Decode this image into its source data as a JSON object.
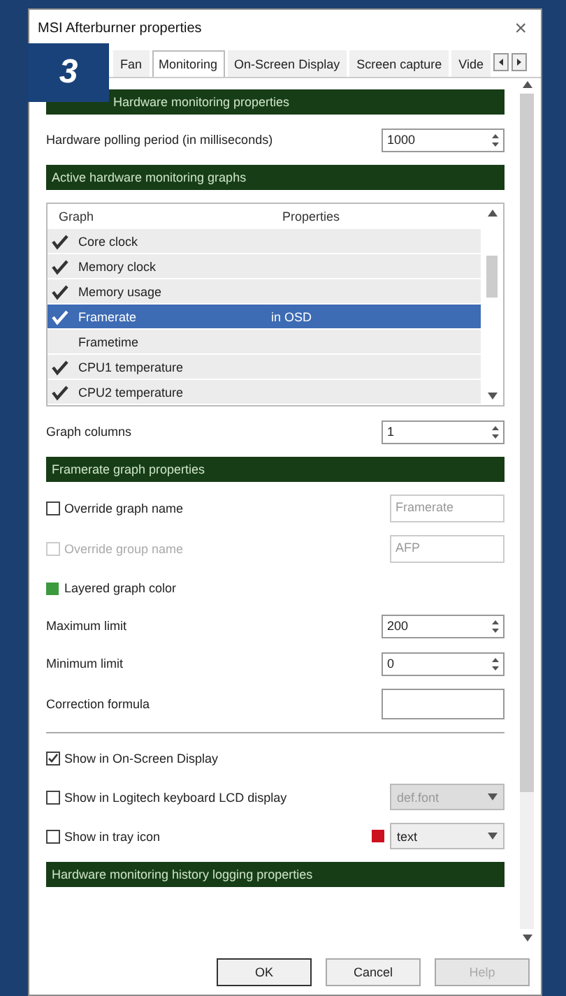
{
  "window": {
    "title": "MSI Afterburner properties",
    "close": "×"
  },
  "badge": "3",
  "tabs": [
    {
      "label": "Fan",
      "selected": false
    },
    {
      "label": "Monitoring",
      "selected": true
    },
    {
      "label": "On-Screen Display",
      "selected": false
    },
    {
      "label": "Screen capture",
      "selected": false
    },
    {
      "label": "Vide",
      "selected": false
    }
  ],
  "hardware_monitoring": {
    "heading": "Hardware monitoring properties",
    "polling_label": "Hardware polling period (in milliseconds)",
    "polling_value": "1000"
  },
  "graphs": {
    "heading": "Active hardware monitoring graphs",
    "columns": [
      "Graph",
      "Properties"
    ],
    "rows": [
      {
        "name": "Core clock",
        "checked": true,
        "selected": false
      },
      {
        "name": "Memory clock",
        "checked": true,
        "selected": false
      },
      {
        "name": "Memory usage",
        "checked": true,
        "selected": false
      },
      {
        "name": "Framerate",
        "properties": "in OSD",
        "checked": true,
        "selected": true
      },
      {
        "name": "Frametime",
        "checked": false,
        "selected": false
      },
      {
        "name": "CPU1 temperature",
        "checked": true,
        "selected": false
      },
      {
        "name": "CPU2 temperature",
        "checked": true,
        "selected": false
      }
    ]
  },
  "graph_columns": {
    "label": "Graph columns",
    "value": "1"
  },
  "graph_properties": {
    "heading": "Framerate graph properties",
    "fields": [
      {
        "kind": "checkbox_text",
        "label": "Override graph name",
        "checked": false,
        "disabled": false,
        "placeholder": "Framerate"
      },
      {
        "kind": "checkbox_text",
        "label": "Override group name",
        "checked": false,
        "disabled": true,
        "placeholder": "AFP"
      },
      {
        "kind": "color",
        "label": "Layered graph color",
        "color": "#3c9a3c"
      },
      {
        "kind": "spin",
        "label": "Maximum limit",
        "value": "200"
      },
      {
        "kind": "spin",
        "label": "Minimum limit",
        "value": "0"
      },
      {
        "kind": "text",
        "label": "Correction formula"
      },
      {
        "kind": "checkbox",
        "label": "Show in On-Screen Display",
        "checked": true
      },
      {
        "kind": "checkbox_select",
        "label": "Show in Logitech keyboard LCD display",
        "checked": false,
        "select": "def.font",
        "select_disabled": true
      },
      {
        "kind": "checkbox_select",
        "label": "Show in tray icon",
        "checked": false,
        "select": "text",
        "select_disabled": false,
        "color": "#cc1020"
      }
    ]
  },
  "logging": {
    "heading": "Hardware monitoring history logging properties"
  },
  "buttons": [
    {
      "label": "OK",
      "default": true,
      "disabled": false
    },
    {
      "label": "Cancel",
      "default": false,
      "disabled": false
    },
    {
      "label": "Help",
      "default": false,
      "disabled": true
    }
  ]
}
